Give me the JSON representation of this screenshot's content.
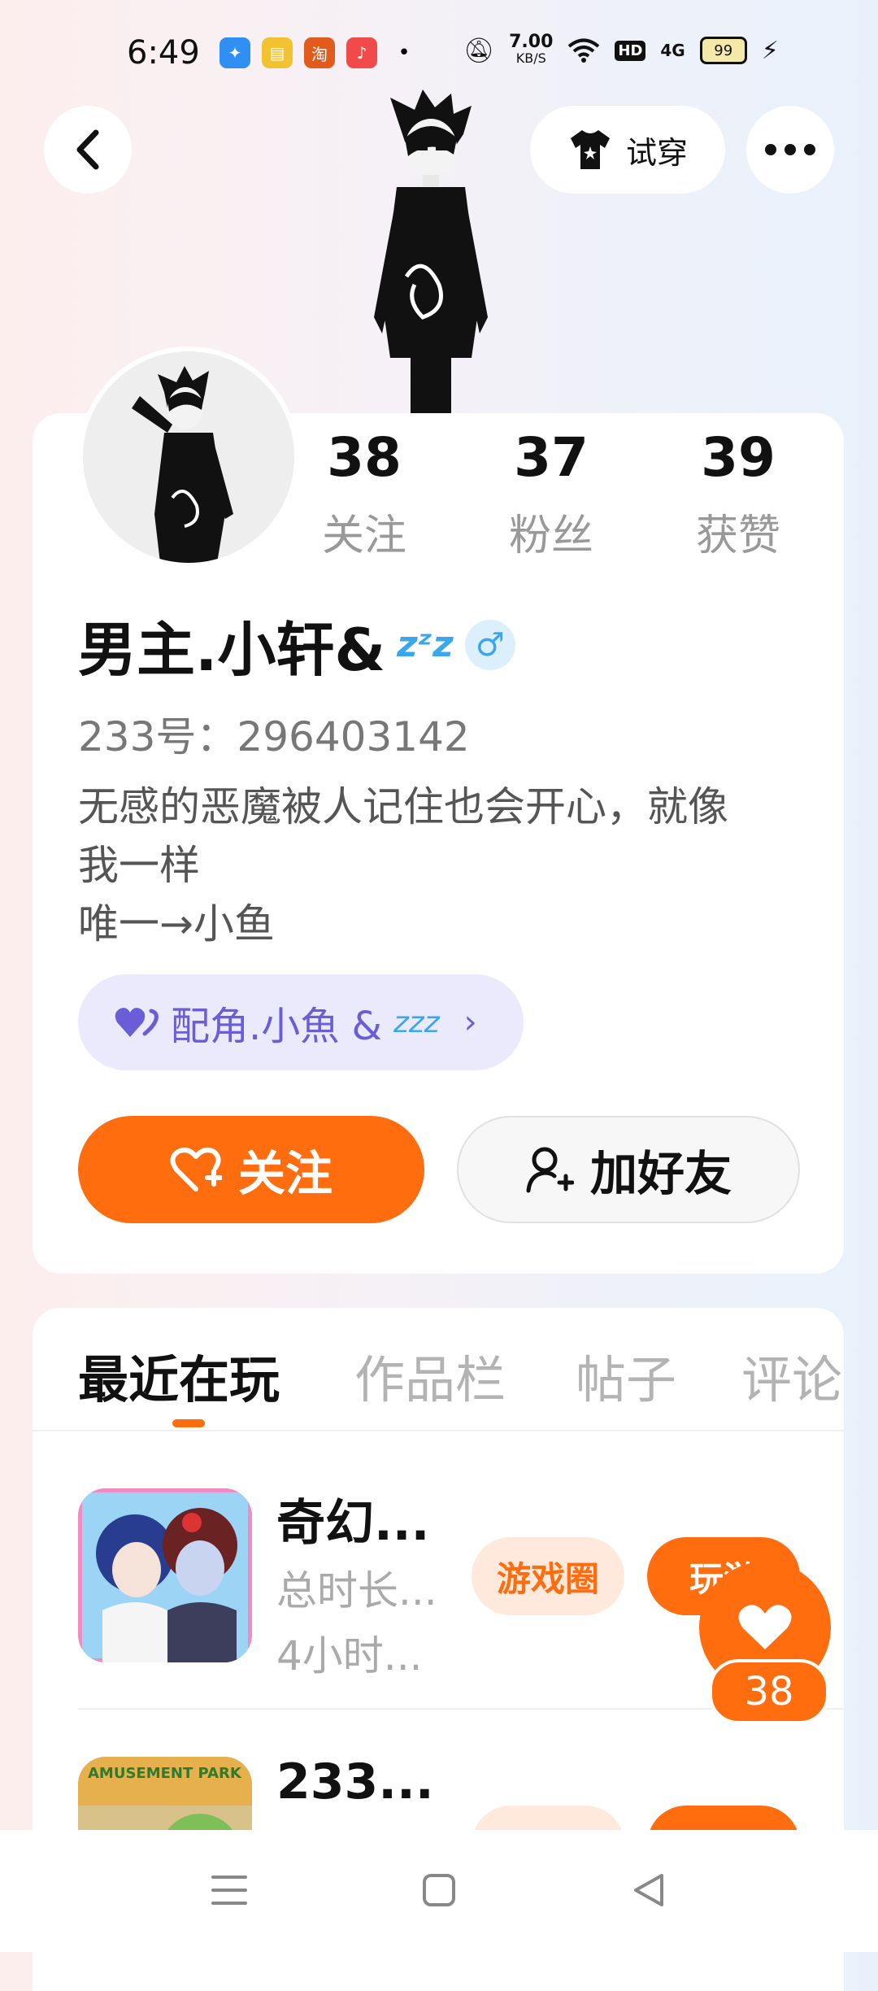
{
  "status_bar": {
    "time": "6:49",
    "net_speed_value": "7.00",
    "net_speed_unit": "KB/S",
    "hd": "HD",
    "signal": "4G",
    "battery": "99"
  },
  "header": {
    "try_on_label": "试穿"
  },
  "profile": {
    "stats": [
      {
        "value": "38",
        "label": "关注"
      },
      {
        "value": "37",
        "label": "粉丝"
      },
      {
        "value": "39",
        "label": "获赞"
      }
    ],
    "name": "男主.小轩&",
    "name_suffix": "zᶻz",
    "gender_symbol": "♂",
    "uid": "233号：296403142",
    "bio_lines": [
      "无感的恶魔被人记住也会开心，就像",
      "我一样",
      "唯一→小鱼"
    ],
    "partner_label": "配角.小魚 &",
    "partner_suffix": "zzz",
    "follow_label": "关注",
    "add_friend_label": "加好友"
  },
  "tabs": [
    "最近在玩",
    "作品栏",
    "帖子",
    "评论"
  ],
  "games": [
    {
      "title": "奇幻...",
      "sub1": "总时长...",
      "sub2": "4小时...",
      "circle_label": "游戏圈",
      "play_label": "玩游"
    },
    {
      "title": "233...",
      "sub_banner": "AMUSEMENT PARK"
    }
  ],
  "floating_like": {
    "count": "38"
  },
  "colors": {
    "accent": "#ff6d0f",
    "partner_bg": "#ebe9fc",
    "partner_text": "#6a5ed8",
    "gender": "#3aa7ea"
  }
}
